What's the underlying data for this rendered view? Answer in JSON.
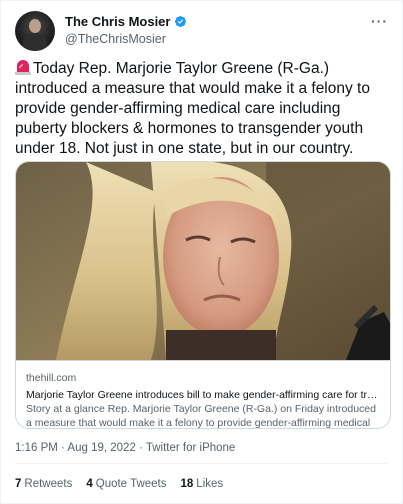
{
  "author": {
    "display_name": "The Chris Mosier",
    "handle": "@TheChrisMosier",
    "verified": true
  },
  "tweet": {
    "text": "Today Rep. Marjorie Taylor Greene (R-Ga.) introduced a measure that would make it a felony to provide gender-affirming medical care including puberty blockers & hormones to transgender youth under 18. Not just in one state, but in our country.",
    "leading_emoji": "siren-icon",
    "timestamp": "1:16 PM · Aug 19, 2022 · Twitter for iPhone"
  },
  "card": {
    "domain": "thehill.com",
    "title": "Marjorie Taylor Greene introduces bill to make gender-affirming care for transg...",
    "description": "Story at a glance Rep. Marjorie Taylor Greene (R-Ga.) on Friday introduced a measure that would make it a felony to provide gender-affirming medical care ..."
  },
  "stats": {
    "retweets_count": "7",
    "retweets_label": "Retweets",
    "quotes_count": "4",
    "quotes_label": "Quote Tweets",
    "likes_count": "18",
    "likes_label": "Likes"
  },
  "colors": {
    "text_primary": "#0f1419",
    "text_secondary": "#536471",
    "verified_blue": "#1d9bf0",
    "border": "#cfd9de"
  }
}
